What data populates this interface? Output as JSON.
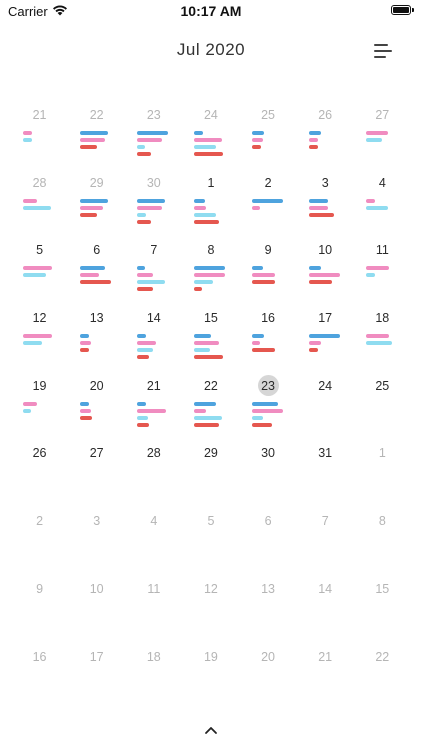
{
  "status_bar": {
    "carrier": "Carrier",
    "time": "10:17 AM"
  },
  "header": {
    "title": "Jul 2020"
  },
  "colors": {
    "blue": "#4ea3de",
    "pink": "#f08cc0",
    "cyan": "#8fdcf0",
    "red": "#e5574f"
  },
  "icons": {
    "menu": "menu-lines-icon",
    "collapse": "chevron-up-icon",
    "wifi": "wifi-icon",
    "battery": "battery-icon"
  },
  "days": [
    {
      "label": "21",
      "month": "other",
      "bars": [
        {
          "c": "pink",
          "w": 0.3
        },
        {
          "c": "cyan",
          "w": 0.3
        }
      ]
    },
    {
      "label": "22",
      "month": "other",
      "bars": [
        {
          "c": "blue",
          "w": 0.9
        },
        {
          "c": "pink",
          "w": 0.8
        },
        {
          "c": "red",
          "w": 0.55
        }
      ]
    },
    {
      "label": "23",
      "month": "other",
      "bars": [
        {
          "c": "blue",
          "w": 1.0
        },
        {
          "c": "pink",
          "w": 0.8
        },
        {
          "c": "cyan",
          "w": 0.25
        },
        {
          "c": "red",
          "w": 0.45
        }
      ]
    },
    {
      "label": "24",
      "month": "other",
      "bars": [
        {
          "c": "blue",
          "w": 0.3
        },
        {
          "c": "pink",
          "w": 0.9
        },
        {
          "c": "cyan",
          "w": 0.7
        },
        {
          "c": "red",
          "w": 0.95
        }
      ]
    },
    {
      "label": "25",
      "month": "other",
      "bars": [
        {
          "c": "blue",
          "w": 0.4
        },
        {
          "c": "pink",
          "w": 0.35
        },
        {
          "c": "red",
          "w": 0.3
        }
      ]
    },
    {
      "label": "26",
      "month": "other",
      "bars": [
        {
          "c": "blue",
          "w": 0.4
        },
        {
          "c": "pink",
          "w": 0.3
        },
        {
          "c": "red",
          "w": 0.3
        }
      ]
    },
    {
      "label": "27",
      "month": "other",
      "bars": [
        {
          "c": "pink",
          "w": 0.7
        },
        {
          "c": "cyan",
          "w": 0.5
        }
      ]
    },
    {
      "label": "28",
      "month": "other",
      "bars": [
        {
          "c": "pink",
          "w": 0.45
        },
        {
          "c": "cyan",
          "w": 0.9
        }
      ]
    },
    {
      "label": "29",
      "month": "other",
      "bars": [
        {
          "c": "blue",
          "w": 0.9
        },
        {
          "c": "pink",
          "w": 0.75
        },
        {
          "c": "red",
          "w": 0.55
        }
      ]
    },
    {
      "label": "30",
      "month": "other",
      "bars": [
        {
          "c": "blue",
          "w": 0.9
        },
        {
          "c": "pink",
          "w": 0.8
        },
        {
          "c": "cyan",
          "w": 0.3
        },
        {
          "c": "red",
          "w": 0.45
        }
      ]
    },
    {
      "label": "1",
      "month": "current",
      "bars": [
        {
          "c": "blue",
          "w": 0.35
        },
        {
          "c": "pink",
          "w": 0.4
        },
        {
          "c": "cyan",
          "w": 0.7
        },
        {
          "c": "red",
          "w": 0.8
        }
      ]
    },
    {
      "label": "2",
      "month": "current",
      "bars": [
        {
          "c": "blue",
          "w": 1.0
        },
        {
          "c": "pink",
          "w": 0.25
        }
      ]
    },
    {
      "label": "3",
      "month": "current",
      "bars": [
        {
          "c": "blue",
          "w": 0.6
        },
        {
          "c": "pink",
          "w": 0.6
        },
        {
          "c": "red",
          "w": 0.8
        }
      ]
    },
    {
      "label": "4",
      "month": "current",
      "bars": [
        {
          "c": "pink",
          "w": 0.3
        },
        {
          "c": "cyan",
          "w": 0.7
        }
      ]
    },
    {
      "label": "5",
      "month": "current",
      "bars": [
        {
          "c": "pink",
          "w": 0.95
        },
        {
          "c": "cyan",
          "w": 0.75
        }
      ]
    },
    {
      "label": "6",
      "month": "current",
      "bars": [
        {
          "c": "blue",
          "w": 0.8
        },
        {
          "c": "pink",
          "w": 0.6
        },
        {
          "c": "red",
          "w": 1.0
        }
      ]
    },
    {
      "label": "7",
      "month": "current",
      "bars": [
        {
          "c": "blue",
          "w": 0.25
        },
        {
          "c": "pink",
          "w": 0.5
        },
        {
          "c": "cyan",
          "w": 0.9
        },
        {
          "c": "red",
          "w": 0.5
        }
      ]
    },
    {
      "label": "8",
      "month": "current",
      "bars": [
        {
          "c": "blue",
          "w": 1.0
        },
        {
          "c": "pink",
          "w": 1.0
        },
        {
          "c": "cyan",
          "w": 0.6
        },
        {
          "c": "red",
          "w": 0.25
        }
      ]
    },
    {
      "label": "9",
      "month": "current",
      "bars": [
        {
          "c": "blue",
          "w": 0.35
        },
        {
          "c": "pink",
          "w": 0.75
        },
        {
          "c": "red",
          "w": 0.75
        }
      ]
    },
    {
      "label": "10",
      "month": "current",
      "bars": [
        {
          "c": "blue",
          "w": 0.4
        },
        {
          "c": "pink",
          "w": 1.0
        },
        {
          "c": "red",
          "w": 0.75
        }
      ]
    },
    {
      "label": "11",
      "month": "current",
      "bars": [
        {
          "c": "pink",
          "w": 0.75
        },
        {
          "c": "cyan",
          "w": 0.3
        }
      ]
    },
    {
      "label": "12",
      "month": "current",
      "bars": [
        {
          "c": "pink",
          "w": 0.95
        },
        {
          "c": "cyan",
          "w": 0.6
        }
      ]
    },
    {
      "label": "13",
      "month": "current",
      "bars": [
        {
          "c": "blue",
          "w": 0.3
        },
        {
          "c": "pink",
          "w": 0.35
        },
        {
          "c": "red",
          "w": 0.3
        }
      ]
    },
    {
      "label": "14",
      "month": "current",
      "bars": [
        {
          "c": "blue",
          "w": 0.3
        },
        {
          "c": "pink",
          "w": 0.6
        },
        {
          "c": "cyan",
          "w": 0.5
        },
        {
          "c": "red",
          "w": 0.4
        }
      ]
    },
    {
      "label": "15",
      "month": "current",
      "bars": [
        {
          "c": "blue",
          "w": 0.55
        },
        {
          "c": "pink",
          "w": 0.8
        },
        {
          "c": "cyan",
          "w": 0.5
        },
        {
          "c": "red",
          "w": 0.95
        }
      ]
    },
    {
      "label": "16",
      "month": "current",
      "bars": [
        {
          "c": "blue",
          "w": 0.4
        },
        {
          "c": "pink",
          "w": 0.25
        },
        {
          "c": "red",
          "w": 0.75
        }
      ]
    },
    {
      "label": "17",
      "month": "current",
      "bars": [
        {
          "c": "blue",
          "w": 1.0
        },
        {
          "c": "pink",
          "w": 0.4
        },
        {
          "c": "red",
          "w": 0.3
        }
      ]
    },
    {
      "label": "18",
      "month": "current",
      "bars": [
        {
          "c": "pink",
          "w": 0.75
        },
        {
          "c": "cyan",
          "w": 0.85
        }
      ]
    },
    {
      "label": "19",
      "month": "current",
      "bars": [
        {
          "c": "pink",
          "w": 0.45
        },
        {
          "c": "cyan",
          "w": 0.25
        }
      ]
    },
    {
      "label": "20",
      "month": "current",
      "bars": [
        {
          "c": "blue",
          "w": 0.3
        },
        {
          "c": "pink",
          "w": 0.35
        },
        {
          "c": "red",
          "w": 0.4
        }
      ]
    },
    {
      "label": "21",
      "month": "current",
      "bars": [
        {
          "c": "blue",
          "w": 0.3
        },
        {
          "c": "pink",
          "w": 0.95
        },
        {
          "c": "cyan",
          "w": 0.35
        },
        {
          "c": "red",
          "w": 0.4
        }
      ]
    },
    {
      "label": "22",
      "month": "current",
      "bars": [
        {
          "c": "blue",
          "w": 0.7
        },
        {
          "c": "pink",
          "w": 0.4
        },
        {
          "c": "cyan",
          "w": 0.9
        },
        {
          "c": "red",
          "w": 0.8
        }
      ]
    },
    {
      "label": "23",
      "month": "current",
      "today": true,
      "bars": [
        {
          "c": "blue",
          "w": 0.85
        },
        {
          "c": "pink",
          "w": 1.0
        },
        {
          "c": "cyan",
          "w": 0.35
        },
        {
          "c": "red",
          "w": 0.65
        }
      ]
    },
    {
      "label": "24",
      "month": "current",
      "bars": []
    },
    {
      "label": "25",
      "month": "current",
      "bars": []
    },
    {
      "label": "26",
      "month": "current",
      "bars": []
    },
    {
      "label": "27",
      "month": "current",
      "bars": []
    },
    {
      "label": "28",
      "month": "current",
      "bars": []
    },
    {
      "label": "29",
      "month": "current",
      "bars": []
    },
    {
      "label": "30",
      "month": "current",
      "bars": []
    },
    {
      "label": "31",
      "month": "current",
      "bars": []
    },
    {
      "label": "1",
      "month": "other",
      "bars": []
    },
    {
      "label": "2",
      "month": "other",
      "bars": []
    },
    {
      "label": "3",
      "month": "other",
      "bars": []
    },
    {
      "label": "4",
      "month": "other",
      "bars": []
    },
    {
      "label": "5",
      "month": "other",
      "bars": []
    },
    {
      "label": "6",
      "month": "other",
      "bars": []
    },
    {
      "label": "7",
      "month": "other",
      "bars": []
    },
    {
      "label": "8",
      "month": "other",
      "bars": []
    },
    {
      "label": "9",
      "month": "other",
      "bars": []
    },
    {
      "label": "10",
      "month": "other",
      "bars": []
    },
    {
      "label": "11",
      "month": "other",
      "bars": []
    },
    {
      "label": "12",
      "month": "other",
      "bars": []
    },
    {
      "label": "13",
      "month": "other",
      "bars": []
    },
    {
      "label": "14",
      "month": "other",
      "bars": []
    },
    {
      "label": "15",
      "month": "other",
      "bars": []
    },
    {
      "label": "16",
      "month": "other",
      "bars": []
    },
    {
      "label": "17",
      "month": "other",
      "bars": []
    },
    {
      "label": "18",
      "month": "other",
      "bars": []
    },
    {
      "label": "19",
      "month": "other",
      "bars": []
    },
    {
      "label": "20",
      "month": "other",
      "bars": []
    },
    {
      "label": "21",
      "month": "other",
      "bars": []
    },
    {
      "label": "22",
      "month": "other",
      "bars": []
    }
  ]
}
